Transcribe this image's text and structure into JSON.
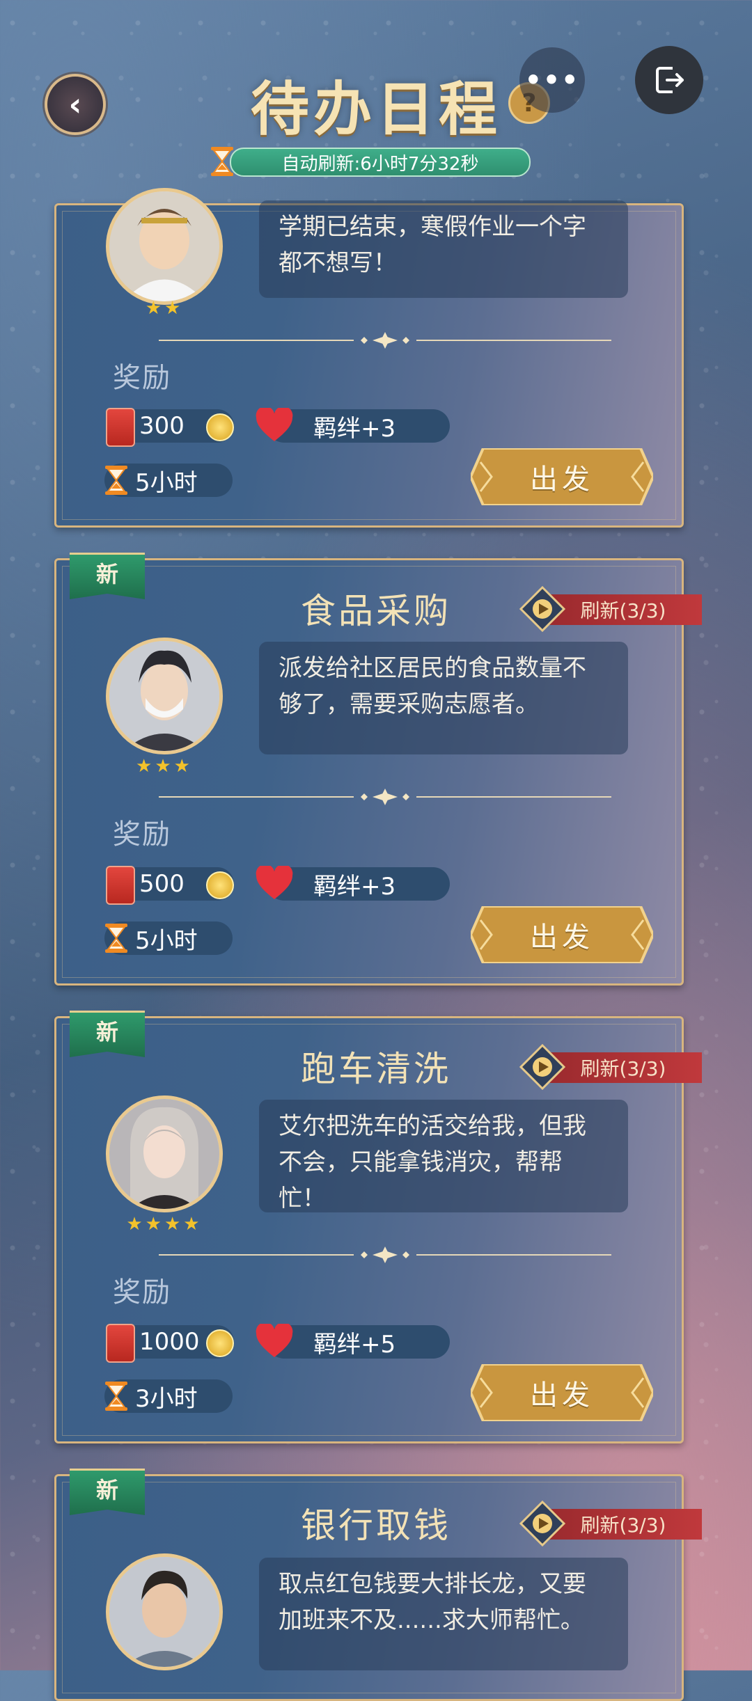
{
  "header": {
    "title": "待办日程",
    "help": "?",
    "more": "•••",
    "refresh_text": "自动刷新:6小时7分32秒"
  },
  "tasks": [
    {
      "title": "",
      "new_tag": "",
      "refresh": "",
      "stars": "★★",
      "description": "学期已结束，寒假作业一个字都不想写！",
      "reward_label": "奖励",
      "coins": "300",
      "bond": "羁绊+3",
      "duration": "5小时",
      "go_label": "出发"
    },
    {
      "title": "食品采购",
      "new_tag": "新",
      "refresh": "刷新(3/3)",
      "stars": "★★★",
      "description": "派发给社区居民的食品数量不够了，需要采购志愿者。",
      "reward_label": "奖励",
      "coins": "500",
      "bond": "羁绊+3",
      "duration": "5小时",
      "go_label": "出发"
    },
    {
      "title": "跑车清洗",
      "new_tag": "新",
      "refresh": "刷新(3/3)",
      "stars": "★★★★",
      "description": "艾尔把洗车的活交给我，但我不会，只能拿钱消灾，帮帮忙！",
      "reward_label": "奖励",
      "coins": "1000",
      "bond": "羁绊+5",
      "duration": "3小时",
      "go_label": "出发"
    },
    {
      "title": "银行取钱",
      "new_tag": "新",
      "refresh": "刷新(3/3)",
      "stars": "",
      "description": "取点红包钱要大排长龙，又要加班来不及......求大师帮忙。",
      "reward_label": "",
      "coins": "",
      "bond": "",
      "duration": "",
      "go_label": ""
    }
  ],
  "colors": {
    "gold": "#d8b57f",
    "title_cream": "#f3e2b6",
    "new_green": "#2f9a6c",
    "refresh_red": "#c0393c",
    "timer_green": "#3fae8a"
  }
}
